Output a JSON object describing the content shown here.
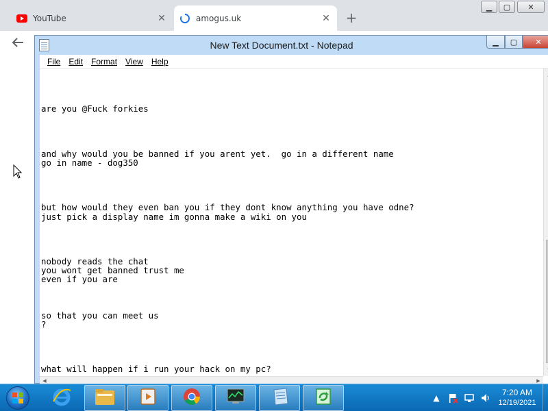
{
  "browser": {
    "tabs": [
      {
        "title": "YouTube",
        "active": false
      },
      {
        "title": "amogus.uk",
        "active": true
      }
    ]
  },
  "notepad": {
    "title": "New Text Document.txt - Notepad",
    "menu": [
      "File",
      "Edit",
      "Format",
      "View",
      "Help"
    ],
    "content": "\n\n\n\nare you @Fuck forkies\n\n\n\n\nand why would you be banned if you arent yet.  go in a different name\ngo in name - dog350\n\n\n\n\nbut how would they even ban you if they dont know anything you have odne?\njust pick a display name im gonna make a wiki on you\n\n\n\n\nnobody reads the chat\nyou wont get banned trust me\neven if you are\n\n\n\nso that you can meet us\n?\n\n\n\n\nwhat will happen if i run your hack on my pc?"
  },
  "taskbar": {
    "apps": [
      {
        "name": "internet-explorer",
        "pinned": false
      },
      {
        "name": "file-explorer",
        "pinned": true
      },
      {
        "name": "media-center",
        "pinned": true
      },
      {
        "name": "chrome",
        "pinned": true
      },
      {
        "name": "task-manager",
        "pinned": true
      },
      {
        "name": "notepad",
        "pinned": true
      },
      {
        "name": "recycle-app",
        "pinned": true
      }
    ],
    "clock": {
      "time": "7:20 AM",
      "date": "12/19/2021"
    }
  },
  "colors": {
    "taskbar": "#0b68b3",
    "notepad_frame": "#bfdbf5",
    "youtube_red": "#ff0000",
    "close_red": "#c94234"
  }
}
